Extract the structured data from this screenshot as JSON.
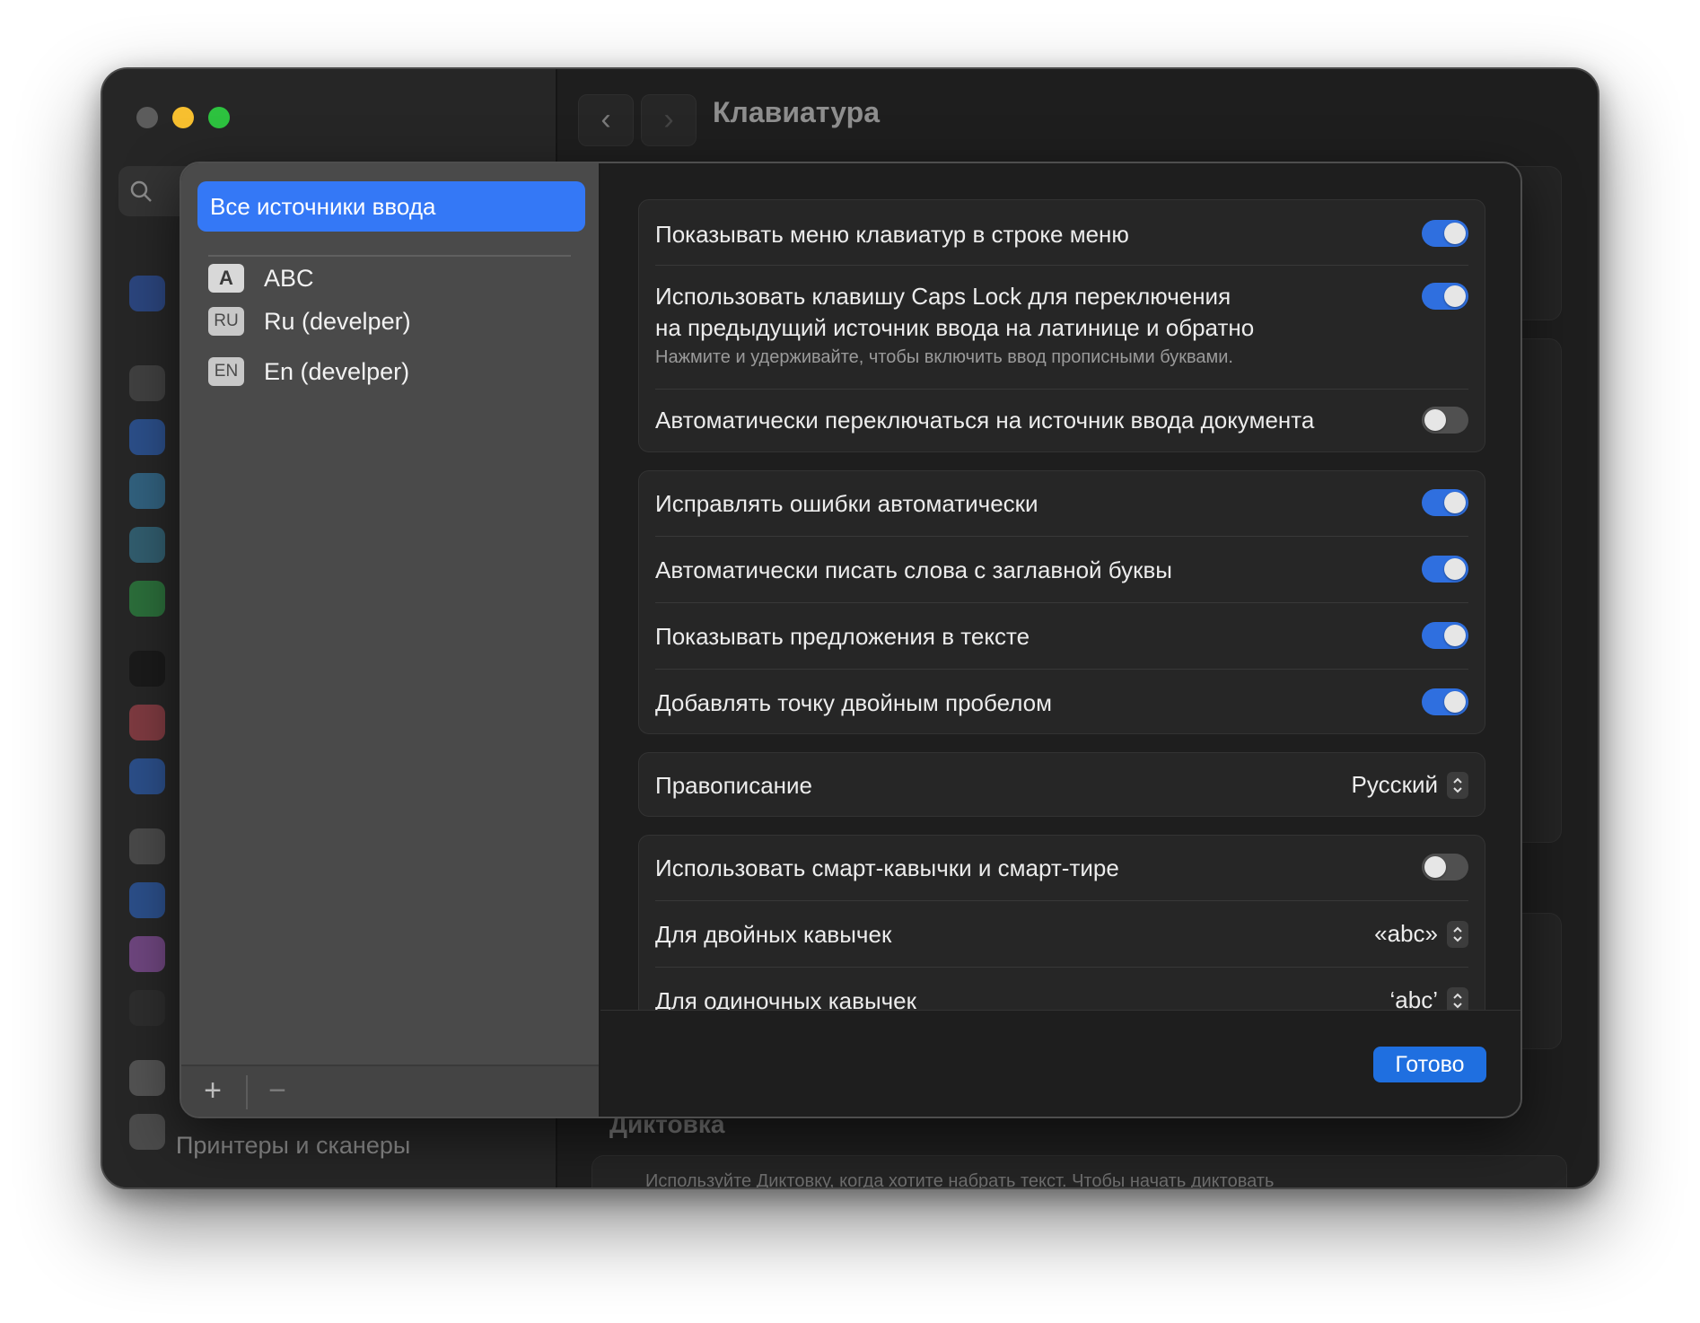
{
  "window": {
    "title": "Клавиатура",
    "sidebar_visible_item": "Принтеры и сканеры",
    "background_section": "Диктовка",
    "background_dictation_text": "Используйте Диктовку, когда хотите набрать текст. Чтобы начать диктовать"
  },
  "sheet": {
    "sources_header": "Все источники ввода",
    "sources": [
      {
        "badge": "A",
        "label": "ABC"
      },
      {
        "badge": "RU",
        "label": "Ru (develper)"
      },
      {
        "badge": "EN",
        "label": "En (develper)"
      }
    ],
    "add_label": "+",
    "remove_label": "−",
    "done_label": "Готово",
    "groups": {
      "input": [
        {
          "label": "Показывать меню клавиатур в строке меню",
          "on": true
        },
        {
          "label_line1": "Использовать клавишу Caps Lock для переключения",
          "label_line2": "на предыдущий источник ввода на латинице и обратно",
          "sub": "Нажмите и удерживайте, чтобы включить ввод прописными буквами.",
          "on": true
        },
        {
          "label": "Автоматически переключаться на источник ввода документа",
          "on": false
        }
      ],
      "text": [
        {
          "label": "Исправлять ошибки автоматически",
          "on": true
        },
        {
          "label": "Автоматически писать слова с заглавной буквы",
          "on": true
        },
        {
          "label": "Показывать предложения в тексте",
          "on": true
        },
        {
          "label": "Добавлять точку двойным пробелом",
          "on": true
        }
      ],
      "spelling": {
        "label": "Правописание",
        "value": "Русский"
      },
      "quotes": {
        "smart": {
          "label": "Использовать смарт-кавычки и смарт-тире",
          "on": false
        },
        "double": {
          "label": "Для двойных кавычек",
          "value": "«abc»"
        },
        "single": {
          "label": "Для одиночных кавычек",
          "value": "‘abc’"
        }
      }
    }
  },
  "colors": {
    "accent": "#3478f6",
    "toggle_on": "#2f6fdf",
    "window_bg": "#1e1e1e"
  }
}
